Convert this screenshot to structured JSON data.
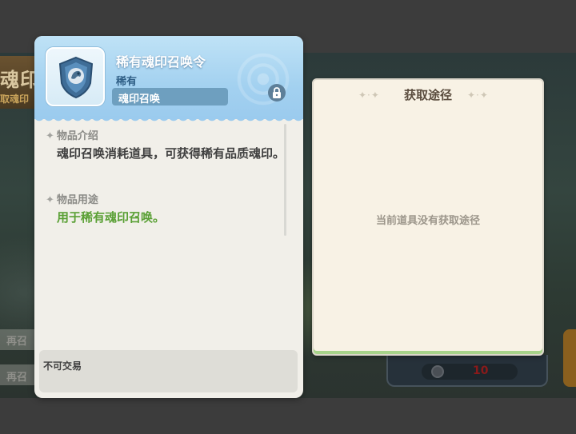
{
  "background": {
    "title": "魂印",
    "subtitle": "取魂印",
    "recall_label_1": "再召",
    "recall_label_2": "再召",
    "cost_value": "10"
  },
  "item": {
    "name": "稀有魂印召唤令",
    "rarity": "稀有",
    "tag": "魂印召唤",
    "icon": "soul-seal-token-icon",
    "intro_title": "物品介绍",
    "intro_text": "魂印召唤消耗道具，可获得稀有品质魂印。",
    "use_title": "物品用途",
    "use_text": "用于稀有魂印召唤。",
    "trade_note": "不可交易"
  },
  "source": {
    "title": "获取途径",
    "empty_text": "当前道具没有获取途径"
  },
  "colors": {
    "header_blue": "#a3d1f0",
    "use_text_green": "#5aa035",
    "panel_cream": "#f8f2e5"
  }
}
